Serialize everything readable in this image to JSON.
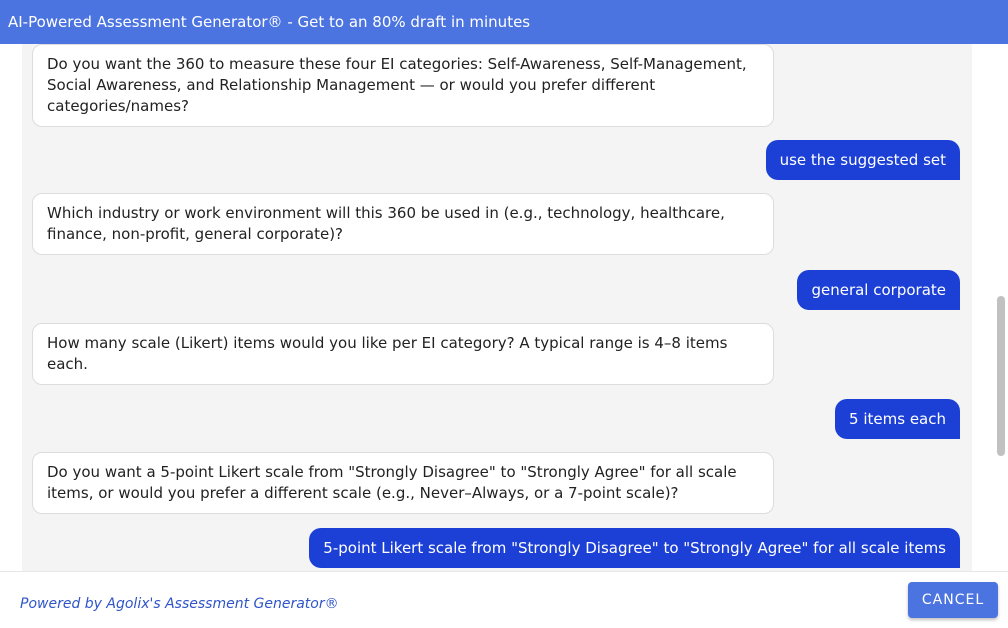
{
  "header": {
    "title": "AI-Powered Assessment Generator® - Get to an 80% draft in minutes"
  },
  "messages": [
    {
      "role": "assistant",
      "text": "Do you want the 360 to measure these four EI categories: Self-Awareness, Self-Management, Social Awareness, and Relationship Management — or would you prefer different categories/names?"
    },
    {
      "role": "user",
      "text": "use the suggested set"
    },
    {
      "role": "assistant",
      "text": "Which industry or work environment will this 360 be used in (e.g., technology, healthcare, finance, non-profit, general corporate)?"
    },
    {
      "role": "user",
      "text": "general corporate"
    },
    {
      "role": "assistant",
      "text": "How many scale (Likert) items would you like per EI category? A typical range is 4–8 items each."
    },
    {
      "role": "user",
      "text": "5 items each"
    },
    {
      "role": "assistant",
      "text": "Do you want a 5-point Likert scale from \"Strongly Disagree\" to \"Strongly Agree\" for all scale items, or would you prefer a different scale (e.g., Never–Always, or a 7-point scale)?"
    },
    {
      "role": "user",
      "text": "5-point Likert scale from \"Strongly Disagree\" to \"Strongly Agree\" for all scale items"
    }
  ],
  "footer": {
    "powered_by": "Powered by Agolix's Assessment Generator®",
    "cancel_label": "CANCEL"
  },
  "colors": {
    "header_bg": "#4b74e1",
    "user_bubble": "#1c40d6",
    "footer_link": "#2f55c9"
  }
}
